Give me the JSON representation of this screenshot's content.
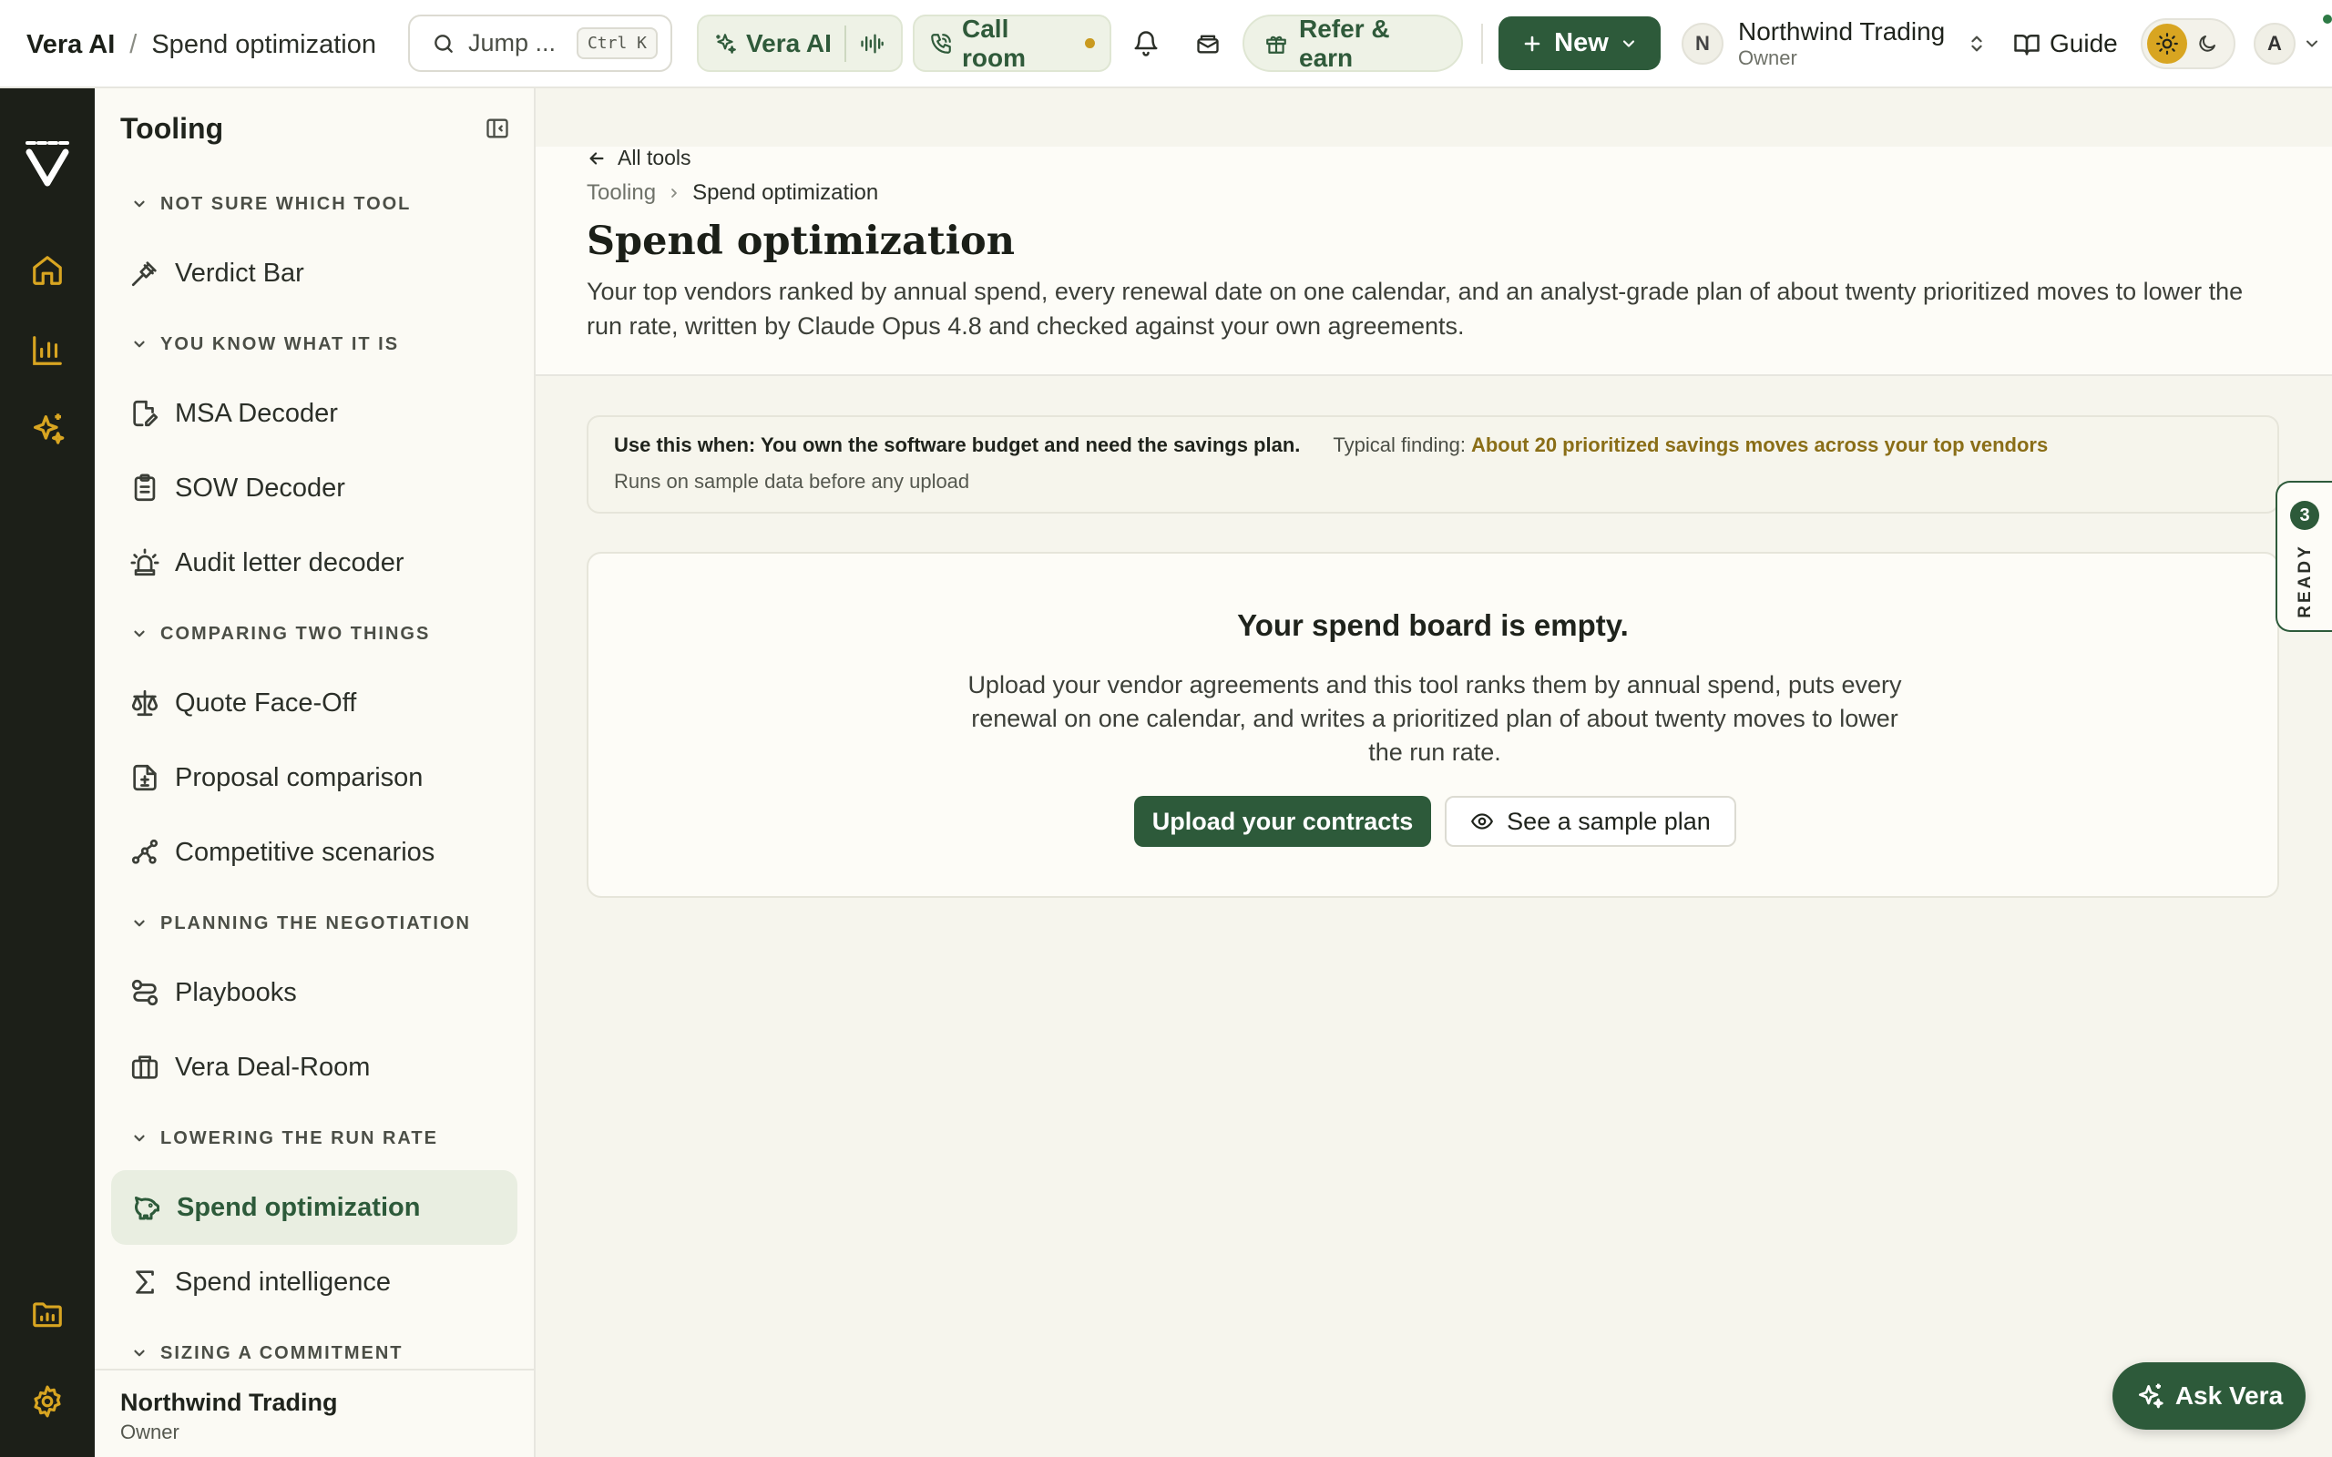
{
  "header": {
    "app_name": "Vera AI",
    "page_name": "Spend optimization",
    "search_placeholder": "Jump ...",
    "search_shortcut": "Ctrl K",
    "vera_ai_label": "Vera AI",
    "call_room_label": "Call room",
    "refer_label": "Refer & earn",
    "new_label": "New",
    "org_initial": "N",
    "org_name": "Northwind Trading",
    "org_role": "Owner",
    "guide_label": "Guide",
    "avatar_initial": "A"
  },
  "sidebar": {
    "title": "Tooling",
    "sections": [
      {
        "label": "NOT SURE WHICH TOOL",
        "items": [
          {
            "label": "Verdict Bar",
            "icon": "gavel-icon"
          }
        ]
      },
      {
        "label": "YOU KNOW WHAT IT IS",
        "items": [
          {
            "label": "MSA Decoder",
            "icon": "file-edit-icon"
          },
          {
            "label": "SOW Decoder",
            "icon": "clipboard-icon"
          },
          {
            "label": "Audit letter decoder",
            "icon": "siren-icon"
          }
        ]
      },
      {
        "label": "COMPARING TWO THINGS",
        "items": [
          {
            "label": "Quote Face-Off",
            "icon": "scale-icon"
          },
          {
            "label": "Proposal comparison",
            "icon": "file-diff-icon"
          },
          {
            "label": "Competitive scenarios",
            "icon": "nodes-icon"
          }
        ]
      },
      {
        "label": "PLANNING THE NEGOTIATION",
        "items": [
          {
            "label": "Playbooks",
            "icon": "route-icon"
          },
          {
            "label": "Vera Deal-Room",
            "icon": "briefcase-icon"
          }
        ]
      },
      {
        "label": "LOWERING THE RUN RATE",
        "items": [
          {
            "label": "Spend optimization",
            "icon": "piggy-bank-icon",
            "active": true
          },
          {
            "label": "Spend intelligence",
            "icon": "sigma-icon"
          }
        ]
      },
      {
        "label": "SIZING A COMMITMENT",
        "items": []
      }
    ],
    "footer": {
      "org_name": "Northwind Trading",
      "role": "Owner"
    }
  },
  "main": {
    "back_label": "All tools",
    "breadcrumb": {
      "parent": "Tooling",
      "current": "Spend optimization"
    },
    "title": "Spend optimization",
    "description": "Your top vendors ranked by annual spend, every renewal date on one calendar, and an analyst-grade plan of about twenty prioritized moves to lower the run rate, written by Claude Opus 4.8 and checked against your own agreements.",
    "info": {
      "use_when": "Use this when: You own the software budget and need the savings plan.",
      "typical_label": "Typical finding:",
      "typical_value": "About 20 prioritized savings moves across your top vendors",
      "note": "Runs on sample data before any upload"
    },
    "empty": {
      "heading": "Your spend board is empty.",
      "body": "Upload your vendor agreements and this tool ranks them by annual spend, puts every renewal on one calendar, and writes a prioritized plan of about twenty moves to lower the run rate.",
      "upload_label": "Upload your contracts",
      "sample_label": "See a sample plan"
    }
  },
  "ready_tab": {
    "count": "3",
    "label": "READY"
  },
  "ask_vera_label": "Ask Vera",
  "colors": {
    "brand": "#2d5a3a",
    "accent_gold": "#d8a521",
    "finding_text": "#8a6e17",
    "rail_bg": "#1c1f18"
  }
}
